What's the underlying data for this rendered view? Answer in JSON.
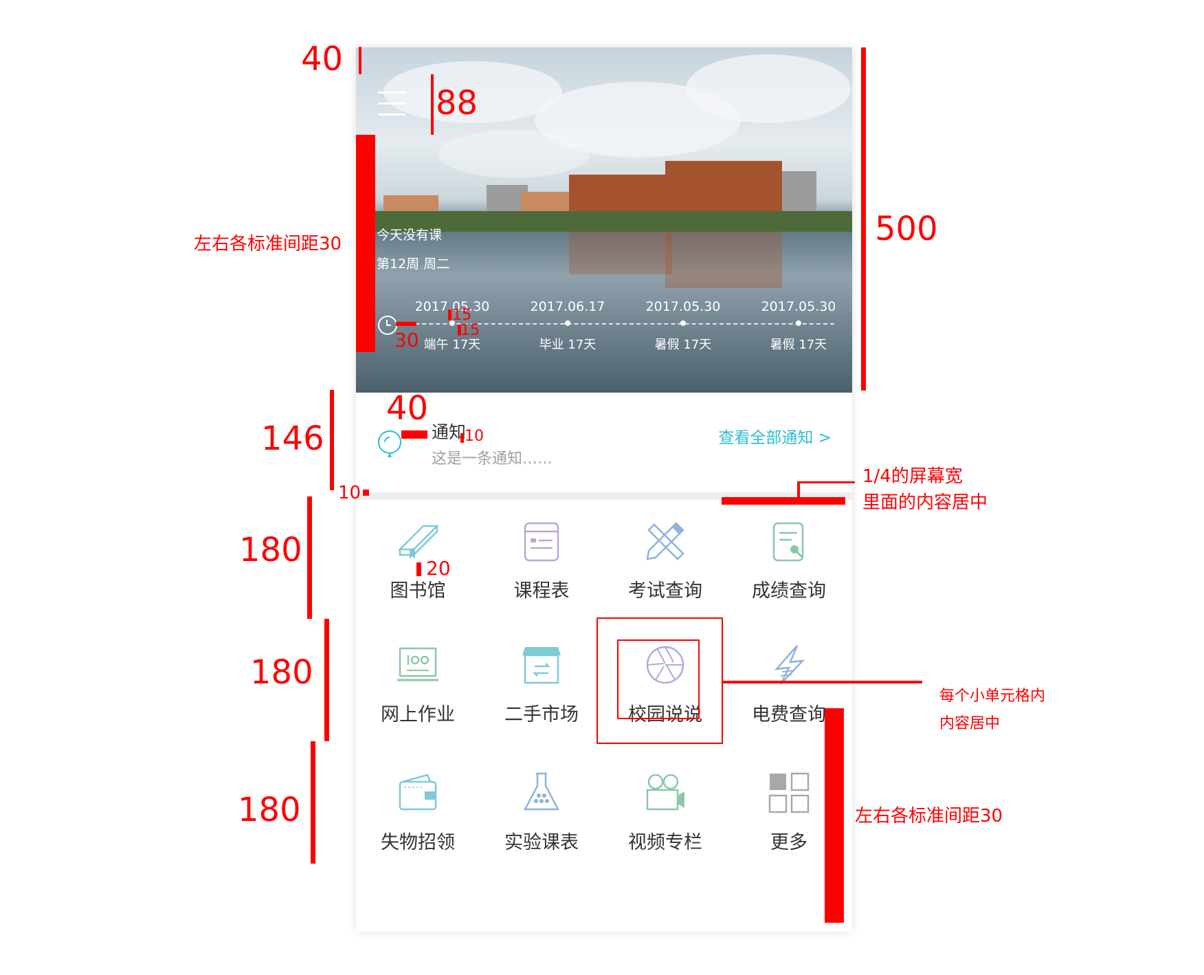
{
  "banner": {
    "today": "今天没有课",
    "week": "第12周 周二",
    "timeline": [
      {
        "date": "2017.05.30",
        "label": "端午  17天"
      },
      {
        "date": "2017.06.17",
        "label": "毕业  17天"
      },
      {
        "date": "2017.05.30",
        "label": "暑假  17天"
      },
      {
        "date": "2017.05.30",
        "label": "暑假  17天"
      }
    ]
  },
  "notice": {
    "title": "通知",
    "text": "这是一条通知……",
    "link": "查看全部通知  >"
  },
  "grid": [
    {
      "label": "图书馆",
      "icon": "book-icon"
    },
    {
      "label": "课程表",
      "icon": "schedule-icon"
    },
    {
      "label": "考试查询",
      "icon": "ruler-pencil-icon"
    },
    {
      "label": "成绩查询",
      "icon": "grade-doc-icon"
    },
    {
      "label": "网上作业",
      "icon": "laptop-icon"
    },
    {
      "label": "二手市场",
      "icon": "shop-icon"
    },
    {
      "label": "校园说说",
      "icon": "aperture-icon"
    },
    {
      "label": "电费查询",
      "icon": "lightning-icon"
    },
    {
      "label": "失物招领",
      "icon": "wallet-icon"
    },
    {
      "label": "实验课表",
      "icon": "flask-icon"
    },
    {
      "label": "视频专栏",
      "icon": "video-camera-icon"
    },
    {
      "label": "更多",
      "icon": "more-grid-icon"
    }
  ],
  "annotations": {
    "top": "40",
    "menu_height": "88",
    "side_padding_left": "左右各标准间距30",
    "banner_height": "500",
    "spacing_15a": "15",
    "spacing_15b": "15",
    "spacing_30": "30",
    "notice_icon_width": "40",
    "spacing_10a": "10",
    "notice_height": "146",
    "divider": "10",
    "quarter_width": "1/4的屏幕宽",
    "content_center": "里面的内容居中",
    "row1": "180",
    "spacing_20": "20",
    "row2": "180",
    "cell_center_1": "每个小单元格内",
    "cell_center_2": "内容居中",
    "row3": "180",
    "side_padding_right": "左右各标准间距30"
  },
  "colors": {
    "annotation": "#ff0000",
    "link": "#2ebcd0",
    "icon_teal": "#7ecad6",
    "icon_purple": "#b9a7d8",
    "icon_green": "#8cc7a8",
    "icon_blue": "#8fb3d9"
  }
}
